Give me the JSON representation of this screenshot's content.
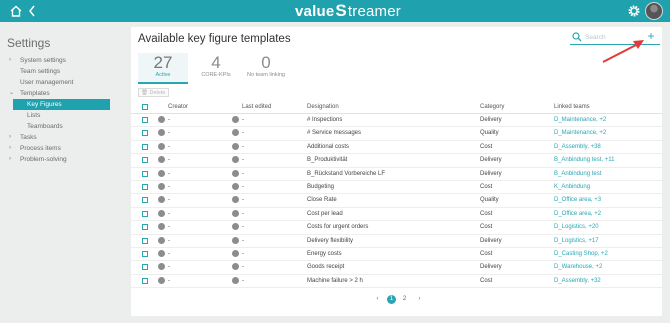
{
  "brand": {
    "logo_left": "value",
    "logo_mid": "S",
    "logo_right": "treamer"
  },
  "sidebar": {
    "title": "Settings",
    "items": [
      {
        "label": "System settings",
        "caret": "›",
        "level": 0,
        "active": false
      },
      {
        "label": "Team settings",
        "caret": "",
        "level": 0,
        "active": false
      },
      {
        "label": "User management",
        "caret": "",
        "level": 0,
        "active": false
      },
      {
        "label": "Templates",
        "caret": "⌄",
        "level": 0,
        "active": false
      },
      {
        "label": "Key Figures",
        "caret": "",
        "level": 1,
        "active": true
      },
      {
        "label": "Lists",
        "caret": "",
        "level": 1,
        "active": false
      },
      {
        "label": "Teamboards",
        "caret": "",
        "level": 1,
        "active": false
      },
      {
        "label": "Tasks",
        "caret": "›",
        "level": 0,
        "active": false
      },
      {
        "label": "Process items",
        "caret": "›",
        "level": 0,
        "active": false
      },
      {
        "label": "Problem-solving",
        "caret": "›",
        "level": 0,
        "active": false
      }
    ]
  },
  "main": {
    "title": "Available key figure templates",
    "search_placeholder": "Search",
    "add_label": "+",
    "stats": [
      {
        "num": "27",
        "label": "Active"
      },
      {
        "num": "4",
        "label": "CORE-KPIs"
      },
      {
        "num": "0",
        "label": "No team linking"
      }
    ],
    "delete_label": "Delete",
    "columns": {
      "creator": "Creator",
      "last_edited": "Last edited",
      "designation": "Designation",
      "category": "Category",
      "linked_teams": "Linked teams"
    },
    "rows": [
      {
        "creator": "-",
        "last_edited": "-",
        "designation": "# Inspections",
        "category": "Delivery",
        "linked_teams": "D_Maintenance, +2"
      },
      {
        "creator": "-",
        "last_edited": "-",
        "designation": "# Service messages",
        "category": "Quality",
        "linked_teams": "D_Maintenance, +2"
      },
      {
        "creator": "-",
        "last_edited": "-",
        "designation": "Additional costs",
        "category": "Cost",
        "linked_teams": "D_Assembly, +38"
      },
      {
        "creator": "-",
        "last_edited": "-",
        "designation": "B_Produktivität",
        "category": "Delivery",
        "linked_teams": "B_Anbindung test, +11"
      },
      {
        "creator": "-",
        "last_edited": "-",
        "designation": "B_Rückstand Vorbereiche LF",
        "category": "Delivery",
        "linked_teams": "B_Anbindung test"
      },
      {
        "creator": "-",
        "last_edited": "-",
        "designation": "Budgeting",
        "category": "Cost",
        "linked_teams": "K_Anbindung"
      },
      {
        "creator": "-",
        "last_edited": "-",
        "designation": "Close Rate",
        "category": "Quality",
        "linked_teams": "D_Office area, +3"
      },
      {
        "creator": "-",
        "last_edited": "-",
        "designation": "Cost per lead",
        "category": "Cost",
        "linked_teams": "D_Office area, +2"
      },
      {
        "creator": "-",
        "last_edited": "-",
        "designation": "Costs for urgent orders",
        "category": "Cost",
        "linked_teams": "D_Logistics, +20"
      },
      {
        "creator": "-",
        "last_edited": "-",
        "designation": "Delivery flexibility",
        "category": "Delivery",
        "linked_teams": "D_Logistics, +17"
      },
      {
        "creator": "-",
        "last_edited": "-",
        "designation": "Energy costs",
        "category": "Cost",
        "linked_teams": "D_Casting Shop, +2"
      },
      {
        "creator": "-",
        "last_edited": "-",
        "designation": "Goods receipt",
        "category": "Delivery",
        "linked_teams": "D_Warehouse, +2"
      },
      {
        "creator": "-",
        "last_edited": "-",
        "designation": "Machine failure > 2 h",
        "category": "Cost",
        "linked_teams": "D_Assembly, +32"
      }
    ],
    "pagination": {
      "prev": "‹",
      "pages": [
        "1",
        "2"
      ],
      "current": "1",
      "next": "›"
    }
  },
  "colors": {
    "accent": "#20a1ae",
    "link": "#2aa6b3",
    "annotation_arrow": "#e03a3a"
  },
  "icons": {
    "home": "home-icon",
    "back": "chevron-left-icon",
    "settings": "gear-icon",
    "search": "search-icon",
    "add": "plus-icon"
  }
}
